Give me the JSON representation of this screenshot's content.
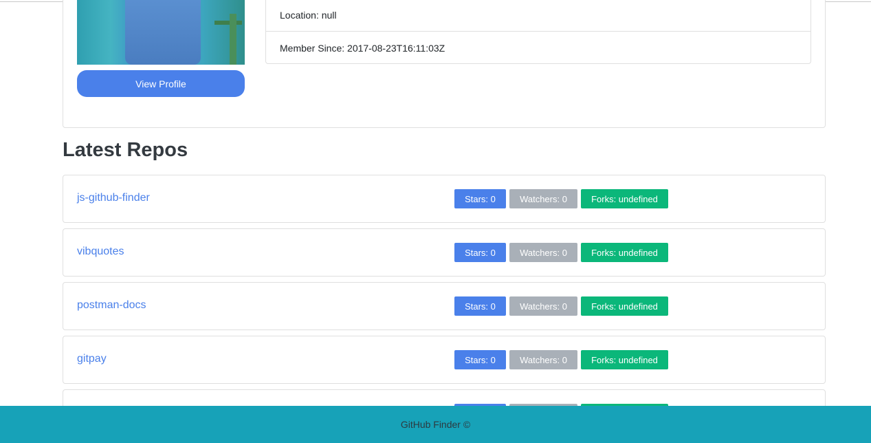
{
  "profile": {
    "view_profile_label": "View Profile",
    "location": "Location: null",
    "member_since": "Member Since: 2017-08-23T16:11:03Z"
  },
  "repos_section": {
    "title": "Latest Repos",
    "repos": [
      {
        "name": "js-github-finder",
        "stars": "Stars: 0",
        "watchers": "Watchers: 0",
        "forks": "Forks: undefined"
      },
      {
        "name": "vibquotes",
        "stars": "Stars: 0",
        "watchers": "Watchers: 0",
        "forks": "Forks: undefined"
      },
      {
        "name": "postman-docs",
        "stars": "Stars: 0",
        "watchers": "Watchers: 0",
        "forks": "Forks: undefined"
      },
      {
        "name": "gitpay",
        "stars": "Stars: 0",
        "watchers": "Watchers: 0",
        "forks": "Forks: undefined"
      },
      {
        "name": "",
        "stars": "",
        "watchers": "",
        "forks": ""
      }
    ]
  },
  "footer": {
    "text": "GitHub Finder ©"
  },
  "colors": {
    "primary": "#4a80ea",
    "secondary": "#a9b0b8",
    "success": "#0bb77a",
    "footer_bg": "#17a2b8"
  }
}
